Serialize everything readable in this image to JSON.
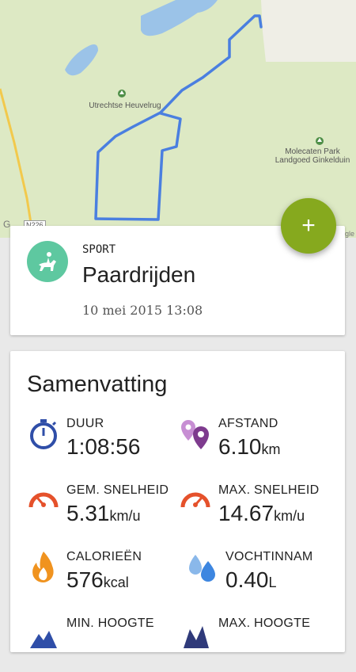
{
  "map": {
    "labels": {
      "heuvelrug": "Utrechtse Heuvelrug",
      "molecaten": "Molecaten Park\nLandgoed Ginkelduin",
      "road": "N226",
      "google_left": "G",
      "google_right": "gle"
    },
    "icons": {
      "park_marker": "park-marker-icon"
    },
    "colors": {
      "land": "#dde9c4",
      "water": "#9bc3e8",
      "route": "#4a7fe0",
      "road": "#f2c94c",
      "urban": "#efeee6"
    }
  },
  "fab": {
    "label": "+",
    "icon": "plus-icon",
    "color": "#86a91e"
  },
  "sport": {
    "kicker": "SPORT",
    "name": "Paardrijden",
    "date": "10 mei 2015 13:08",
    "icon": "horse-riding-icon",
    "color": "#5ec8a0"
  },
  "summary": {
    "title": "Samenvatting",
    "stats": [
      {
        "label": "DUUR",
        "value": "1:08:56",
        "unit": "",
        "icon": "stopwatch-icon"
      },
      {
        "label": "AFSTAND",
        "value": "6.10",
        "unit": "km",
        "icon": "location-pins-icon"
      },
      {
        "label": "GEM. SNELHEID",
        "value": "5.31",
        "unit": "km/u",
        "icon": "speedometer-icon"
      },
      {
        "label": "MAX. SNELHEID",
        "value": "14.67",
        "unit": "km/u",
        "icon": "speedometer-max-icon"
      },
      {
        "label": "CALORIEËN",
        "value": "576",
        "unit": "kcal",
        "icon": "flame-icon"
      },
      {
        "label": "VOCHTINNAM",
        "value": "0.40",
        "unit": "L",
        "icon": "water-drops-icon"
      },
      {
        "label": "MIN. HOOGTE",
        "value": "",
        "unit": "",
        "icon": "altitude-min-icon"
      },
      {
        "label": "MAX. HOOGTE",
        "value": "",
        "unit": "",
        "icon": "altitude-max-icon"
      }
    ]
  }
}
